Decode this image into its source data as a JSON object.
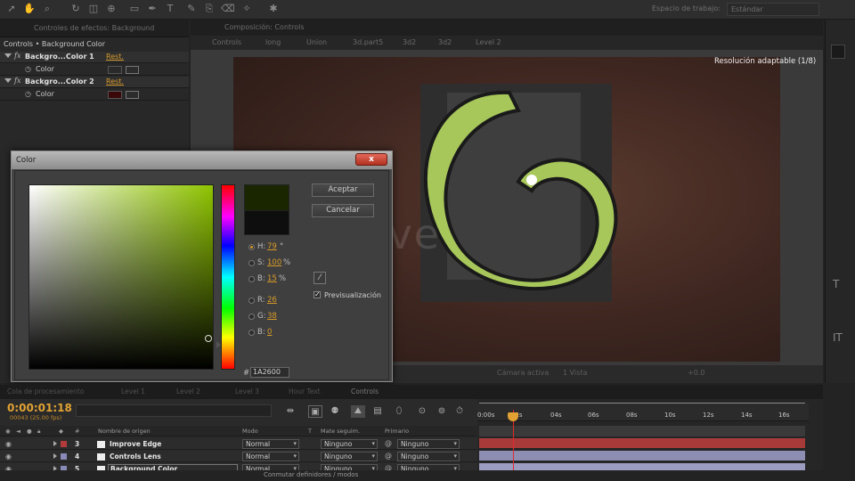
{
  "toolbar": {
    "workspace_label": "Espacio de trabajo:",
    "workspace_value": "Estándar"
  },
  "effects_panel": {
    "tab_title": "Controles de efectos: Background",
    "subtitle": "Controls • Background Color",
    "effects": [
      {
        "name": "Backgro...Color 1",
        "reset": "Rest.",
        "prop": "Color",
        "swatch": "#2a2a2a"
      },
      {
        "name": "Backgro...Color 2",
        "reset": "Rest.",
        "prop": "Color",
        "swatch": "#3a0808"
      }
    ]
  },
  "comp_panel": {
    "tab_title": "Composición: Controls",
    "breadcrumbs": [
      "Controls",
      "long",
      "Union",
      "3d.part5",
      "3d2",
      "3d2",
      "Level 2"
    ],
    "resolution": "Resolución adaptable (1/8)",
    "watermark": "videohive",
    "footer": [
      "Cámara activa",
      "1 Vista",
      "+0.0"
    ]
  },
  "color_dialog": {
    "title": "Color",
    "close_symbol": "x",
    "accept": "Aceptar",
    "cancel": "Cancelar",
    "preview_label": "Previsualización",
    "fields": [
      {
        "label": "H:",
        "value": "79",
        "unit": "°"
      },
      {
        "label": "S:",
        "value": "100",
        "unit": "%"
      },
      {
        "label": "B:",
        "value": "15",
        "unit": "%"
      },
      {
        "label": "R:",
        "value": "26",
        "unit": ""
      },
      {
        "label": "G:",
        "value": "38",
        "unit": ""
      },
      {
        "label": "B:",
        "value": "0",
        "unit": ""
      }
    ],
    "hex_hash": "#",
    "hex_value": "1A2600",
    "new_color": "#1a2600"
  },
  "bottom_tabs": [
    "Cola de procesamiento",
    "Level 1",
    "Level 2",
    "Level 3",
    "Hour Text",
    "Controls"
  ],
  "timeline": {
    "timecode": "0:00:01:18",
    "frame_info": "00043 (25.00 fps)",
    "columns": {
      "hash": "#",
      "source_name": "Nombre de origen",
      "mode": "Modo",
      "t": "T",
      "track_matte": "Mate seguim.",
      "parent": "Primario"
    },
    "layers": [
      {
        "num": "3",
        "name": "Improve Edge",
        "label_color": "#b23a3a",
        "mode": "Normal",
        "matte": "Ninguno",
        "parent": "Ninguno",
        "bar_color": "#a83a3a"
      },
      {
        "num": "4",
        "name": "Controls Lens",
        "label_color": "#8a8ab8",
        "mode": "Normal",
        "matte": "Ninguno",
        "parent": "Ninguno",
        "bar_color": "#8e8eb2"
      },
      {
        "num": "5",
        "name": "Background Color",
        "label_color": "#8a8ab8",
        "mode": "Normal",
        "matte": "Ninguno",
        "parent": "Ninguno",
        "bar_color": "#9c9cc0"
      }
    ],
    "ruler_ticks": [
      "0:00s",
      "02s",
      "04s",
      "06s",
      "08s",
      "10s",
      "12s",
      "14s",
      "16s"
    ],
    "playhead_time": "1:18"
  },
  "bottom_strip": {
    "button": "Conmutar definidores / modos"
  }
}
